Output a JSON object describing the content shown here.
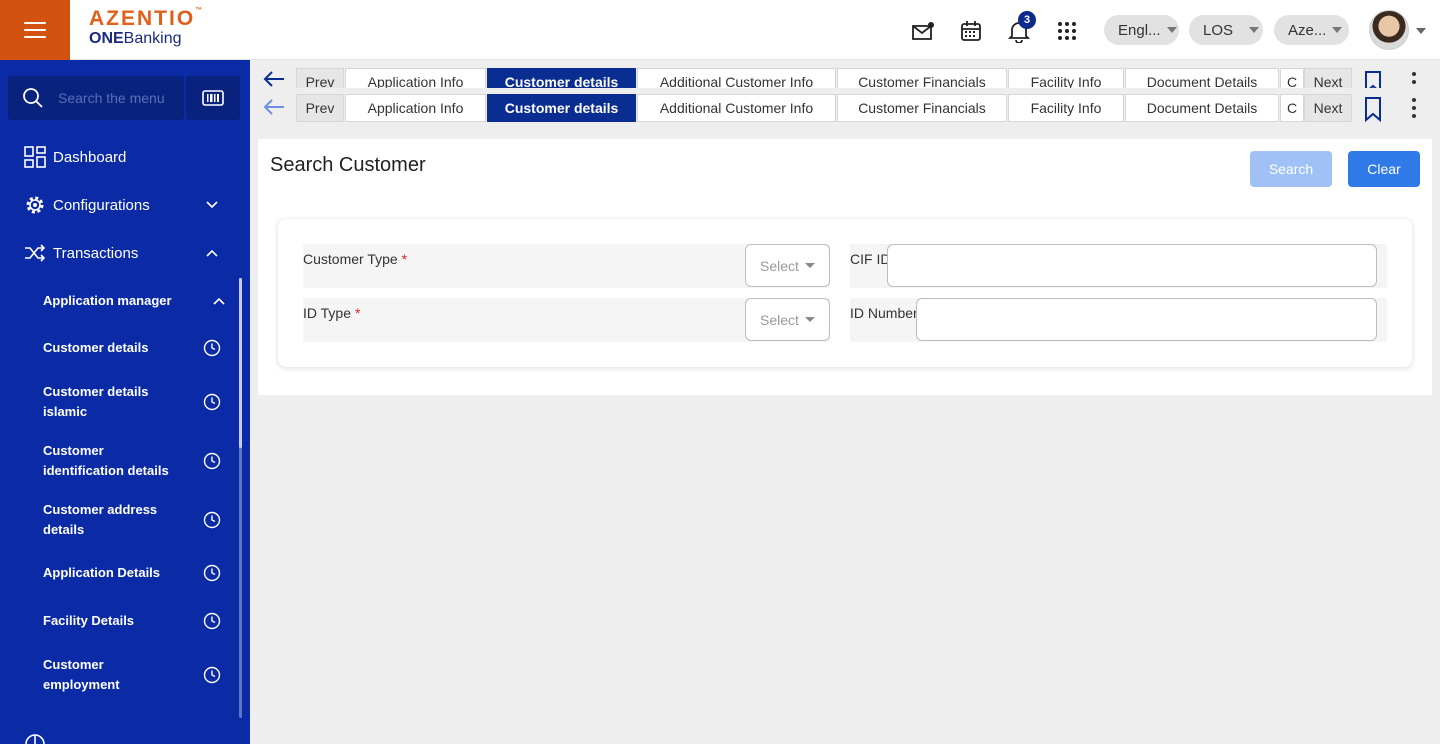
{
  "header": {
    "logo_main": "AZENTIO",
    "logo_tm": "™",
    "logo_sub_bold": "ONE",
    "logo_sub_rest": "Banking",
    "notification_count": "3",
    "language": "Engl...",
    "module": "LOS",
    "entity": "Aze..."
  },
  "sidebar": {
    "search_placeholder": "Search the menu",
    "items": [
      {
        "label": "Dashboard"
      },
      {
        "label": "Configurations"
      },
      {
        "label": "Transactions"
      }
    ],
    "group_label": "Application manager",
    "sub_items": [
      {
        "label": "Customer details"
      },
      {
        "label": "Customer details islamic"
      },
      {
        "label": "Customer identification details"
      },
      {
        "label": "Customer address details"
      },
      {
        "label": "Application Details"
      },
      {
        "label": "Facility Details"
      },
      {
        "label": "Customer employment"
      }
    ]
  },
  "tabs": {
    "prev": "Prev",
    "next": "Next",
    "items": [
      {
        "label": "Application Info"
      },
      {
        "label": "Customer details"
      },
      {
        "label": "Additional Customer Info"
      },
      {
        "label": "Customer Financials"
      },
      {
        "label": "Facility Info"
      },
      {
        "label": "Document Details"
      },
      {
        "label": "C"
      }
    ],
    "active_index": 1
  },
  "main": {
    "title": "Search Customer",
    "search_button": "Search",
    "clear_button": "Clear",
    "fields": {
      "customer_type_label": "Customer Type",
      "customer_type_value": "Select",
      "cif_id_label": "CIF ID",
      "id_type_label": "ID Type",
      "id_type_value": "Select",
      "id_number_label": "ID Number",
      "required_mark": "*"
    }
  },
  "colors": {
    "brand_orange": "#d4520f",
    "sidebar_blue": "#0a2aa6",
    "active_tab": "#0a2d91",
    "primary_button": "#2f7ae6",
    "disabled_button": "#9fc1f5"
  }
}
